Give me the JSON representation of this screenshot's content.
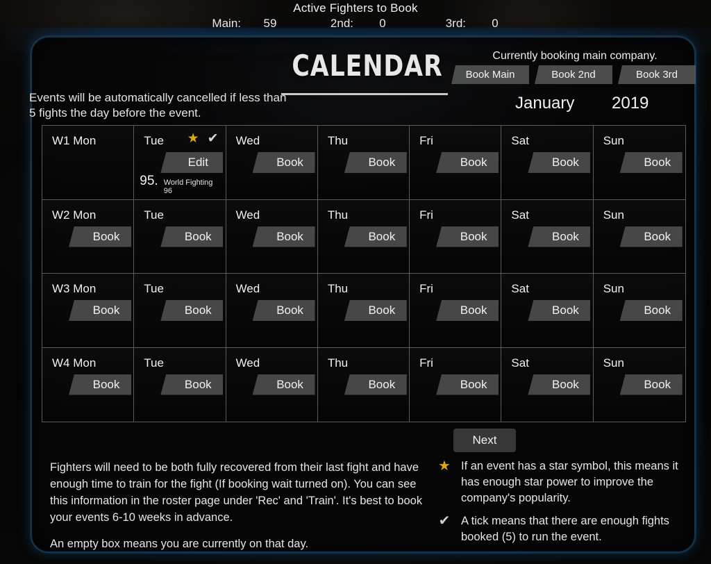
{
  "topbar": {
    "title": "Active Fighters to Book",
    "counters": [
      {
        "label": "Main:",
        "value": "59"
      },
      {
        "label": "2nd:",
        "value": "0"
      },
      {
        "label": "3rd:",
        "value": "0"
      }
    ]
  },
  "header": {
    "title": "CALENDAR",
    "intro_note": "Events will be automatically cancelled if less than 5 fights the day before the event.",
    "booking_status": "Currently booking main company.",
    "book_buttons": [
      {
        "label": "Book Main"
      },
      {
        "label": "Book 2nd"
      },
      {
        "label": "Book 3rd"
      }
    ],
    "month": "January",
    "year": "2019"
  },
  "grid": {
    "rows": [
      {
        "week": "W1",
        "cells": [
          {
            "day": "W1 Mon",
            "state": "empty"
          },
          {
            "day": "Tue",
            "state": "booked",
            "action_label": "Edit",
            "star": true,
            "tick": true,
            "rating": "95.",
            "event_name": "World Fighting 96"
          },
          {
            "day": "Wed",
            "state": "open",
            "action_label": "Book"
          },
          {
            "day": "Thu",
            "state": "open",
            "action_label": "Book"
          },
          {
            "day": "Fri",
            "state": "open",
            "action_label": "Book"
          },
          {
            "day": "Sat",
            "state": "open",
            "action_label": "Book"
          },
          {
            "day": "Sun",
            "state": "open",
            "action_label": "Book"
          }
        ]
      },
      {
        "week": "W2",
        "cells": [
          {
            "day": "W2 Mon",
            "state": "open",
            "action_label": "Book"
          },
          {
            "day": "Tue",
            "state": "open",
            "action_label": "Book"
          },
          {
            "day": "Wed",
            "state": "open",
            "action_label": "Book"
          },
          {
            "day": "Thu",
            "state": "open",
            "action_label": "Book"
          },
          {
            "day": "Fri",
            "state": "open",
            "action_label": "Book"
          },
          {
            "day": "Sat",
            "state": "open",
            "action_label": "Book"
          },
          {
            "day": "Sun",
            "state": "open",
            "action_label": "Book"
          }
        ]
      },
      {
        "week": "W3",
        "cells": [
          {
            "day": "W3 Mon",
            "state": "open",
            "action_label": "Book"
          },
          {
            "day": "Tue",
            "state": "open",
            "action_label": "Book"
          },
          {
            "day": "Wed",
            "state": "open",
            "action_label": "Book"
          },
          {
            "day": "Thu",
            "state": "open",
            "action_label": "Book"
          },
          {
            "day": "Fri",
            "state": "open",
            "action_label": "Book"
          },
          {
            "day": "Sat",
            "state": "open",
            "action_label": "Book"
          },
          {
            "day": "Sun",
            "state": "open",
            "action_label": "Book"
          }
        ]
      },
      {
        "week": "W4",
        "cells": [
          {
            "day": "W4 Mon",
            "state": "open",
            "action_label": "Book"
          },
          {
            "day": "Tue",
            "state": "open",
            "action_label": "Book"
          },
          {
            "day": "Wed",
            "state": "open",
            "action_label": "Book"
          },
          {
            "day": "Thu",
            "state": "open",
            "action_label": "Book"
          },
          {
            "day": "Fri",
            "state": "open",
            "action_label": "Book"
          },
          {
            "day": "Sat",
            "state": "open",
            "action_label": "Book"
          },
          {
            "day": "Sun",
            "state": "open",
            "action_label": "Book"
          }
        ]
      }
    ]
  },
  "next_button": {
    "label": "Next"
  },
  "footer": {
    "paragraphs": [
      "Fighters will need to be both fully recovered from their last fight and have enough time to train for the fight (If booking wait turned on). You can see this information in the roster page under 'Rec' and  'Train'. It's best to book your events 6-10 weeks in advance.",
      "An empty box means you are currently on that day."
    ],
    "legend": [
      {
        "icon": "star-icon",
        "glyph": "★",
        "text": "If an event has a star symbol, this means it has enough star power to improve the company's popularity."
      },
      {
        "icon": "tick-icon",
        "glyph": "✔",
        "text": "A tick means that there are enough fights booked (5) to run the event."
      }
    ]
  },
  "colors": {
    "star": "#d8aa16",
    "tick": "#d6d6d6",
    "panel_border": "#12344f",
    "grid_line": "#5b5b5b",
    "button_bg": "#606060"
  }
}
